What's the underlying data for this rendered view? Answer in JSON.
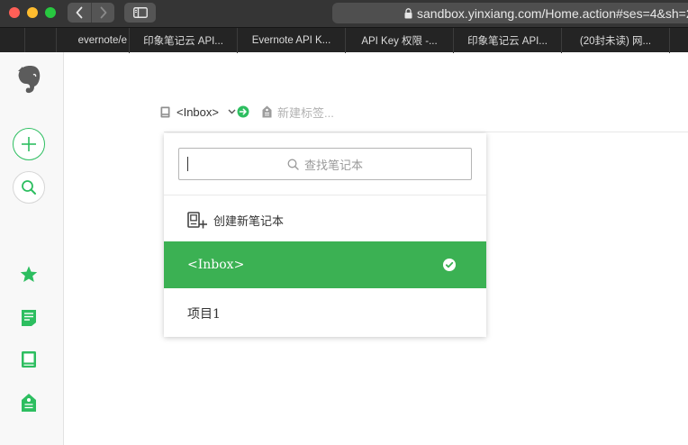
{
  "browser": {
    "url": "sandbox.yinxiang.com/Home.action#ses=4&sh=2&sd",
    "tabs": [
      {
        "label": ""
      },
      {
        "label": "evernote/e"
      },
      {
        "label": "印象笔记云 API..."
      },
      {
        "label": "Evernote API K..."
      },
      {
        "label": "API Key 权限 -..."
      },
      {
        "label": "印象笔记云 API..."
      },
      {
        "label": "(20封未读) 网..."
      },
      {
        "label": ""
      }
    ]
  },
  "sidebar": {
    "icons": [
      "evernote-logo-icon",
      "new-note-icon",
      "search-icon",
      "shortcuts-star-icon",
      "notes-icon",
      "notebooks-icon",
      "tags-icon"
    ],
    "accent": "#2dbe60"
  },
  "note_header": {
    "notebook": "<Inbox>",
    "tag_placeholder": "新建标签..."
  },
  "notebook_menu": {
    "search_placeholder": "查找笔记本",
    "create_label": "创建新笔记本",
    "items": [
      {
        "label": "<Inbox>",
        "selected": true
      },
      {
        "label": "项目1",
        "selected": false
      }
    ],
    "selected_color": "#3bb153"
  }
}
